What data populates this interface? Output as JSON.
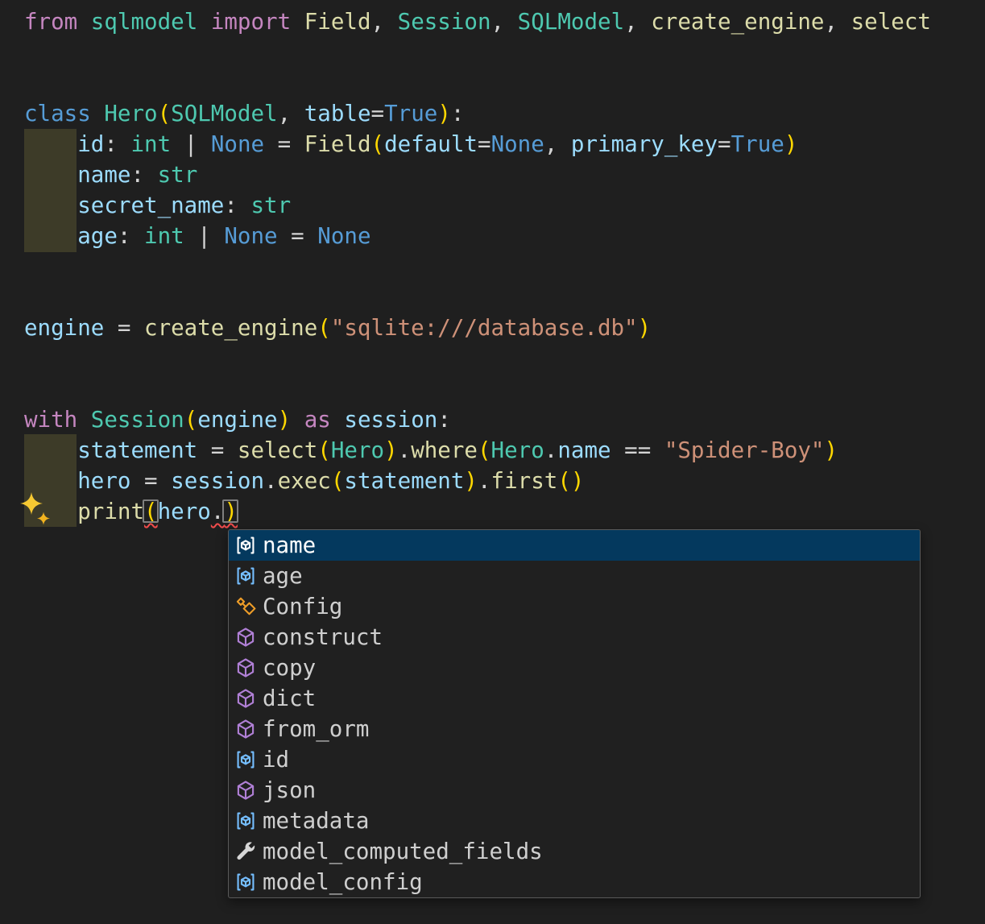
{
  "palette": {
    "editor_bg": "#1f1f1f",
    "keyword_pink": "#C586C0",
    "keyword_blue": "#569CD6",
    "class_teal": "#4EC9B0",
    "function_yellow": "#DCDCAA",
    "variable_blue": "#9CDCFE",
    "string_salmon": "#CE9178",
    "bracket_gold": "#FFD700",
    "error_squiggle": "#F14C4C",
    "indent_highlight": "#3d3b28",
    "suggest_bg": "#202020",
    "suggest_border": "#5a5a5a",
    "suggest_selected_bg": "#04395e",
    "sparkle_gold": "#F5C230"
  },
  "editor": {
    "lines": [
      [
        [
          "from ",
          "kw"
        ],
        [
          "sqlmodel",
          "type"
        ],
        [
          " ",
          "pl"
        ],
        [
          "import",
          "kw"
        ],
        [
          " ",
          "pl"
        ],
        [
          "Field",
          "fn"
        ],
        [
          ", ",
          "pl"
        ],
        [
          "Session",
          "type"
        ],
        [
          ", ",
          "pl"
        ],
        [
          "SQLModel",
          "type"
        ],
        [
          ", ",
          "pl"
        ],
        [
          "create_engine",
          "fn"
        ],
        [
          ", ",
          "pl"
        ],
        [
          "select",
          "fn"
        ]
      ],
      [],
      [],
      [
        [
          "class ",
          "kw2"
        ],
        [
          "Hero",
          "type"
        ],
        [
          "(",
          "br"
        ],
        [
          "SQLModel",
          "type"
        ],
        [
          ", ",
          "pl"
        ],
        [
          "table",
          "var"
        ],
        [
          "=",
          "pl"
        ],
        [
          "True",
          "const"
        ],
        [
          ")",
          "br"
        ],
        [
          ":",
          "pl"
        ]
      ],
      [
        [
          "    ",
          "pl"
        ],
        [
          "id",
          "var"
        ],
        [
          ": ",
          "pl"
        ],
        [
          "int",
          "type"
        ],
        [
          " | ",
          "pl"
        ],
        [
          "None",
          "const"
        ],
        [
          " = ",
          "pl"
        ],
        [
          "Field",
          "fn"
        ],
        [
          "(",
          "br"
        ],
        [
          "default",
          "var"
        ],
        [
          "=",
          "pl"
        ],
        [
          "None",
          "const"
        ],
        [
          ", ",
          "pl"
        ],
        [
          "primary_key",
          "var"
        ],
        [
          "=",
          "pl"
        ],
        [
          "True",
          "const"
        ],
        [
          ")",
          "br"
        ]
      ],
      [
        [
          "    ",
          "pl"
        ],
        [
          "name",
          "var"
        ],
        [
          ": ",
          "pl"
        ],
        [
          "str",
          "type"
        ]
      ],
      [
        [
          "    ",
          "pl"
        ],
        [
          "secret_name",
          "var"
        ],
        [
          ": ",
          "pl"
        ],
        [
          "str",
          "type"
        ]
      ],
      [
        [
          "    ",
          "pl"
        ],
        [
          "age",
          "var"
        ],
        [
          ": ",
          "pl"
        ],
        [
          "int",
          "type"
        ],
        [
          " | ",
          "pl"
        ],
        [
          "None",
          "const"
        ],
        [
          " = ",
          "pl"
        ],
        [
          "None",
          "const"
        ]
      ],
      [],
      [],
      [
        [
          "engine",
          "var"
        ],
        [
          " = ",
          "pl"
        ],
        [
          "create_engine",
          "fn"
        ],
        [
          "(",
          "br"
        ],
        [
          "\"sqlite:///database.db\"",
          "str"
        ],
        [
          ")",
          "br"
        ]
      ],
      [],
      [],
      [
        [
          "with ",
          "kw"
        ],
        [
          "Session",
          "type"
        ],
        [
          "(",
          "br"
        ],
        [
          "engine",
          "var"
        ],
        [
          ")",
          "br"
        ],
        [
          " as ",
          "kw"
        ],
        [
          "session",
          "var"
        ],
        [
          ":",
          "pl"
        ]
      ],
      [
        [
          "    ",
          "pl"
        ],
        [
          "statement",
          "var"
        ],
        [
          " = ",
          "pl"
        ],
        [
          "select",
          "fn"
        ],
        [
          "(",
          "br"
        ],
        [
          "Hero",
          "type"
        ],
        [
          ")",
          "br"
        ],
        [
          ".",
          "pl"
        ],
        [
          "where",
          "fn"
        ],
        [
          "(",
          "br"
        ],
        [
          "Hero",
          "type"
        ],
        [
          ".",
          "pl"
        ],
        [
          "name",
          "var"
        ],
        [
          " == ",
          "pl"
        ],
        [
          "\"Spider-Boy\"",
          "str"
        ],
        [
          ")",
          "br"
        ]
      ],
      [
        [
          "    ",
          "pl"
        ],
        [
          "hero",
          "var"
        ],
        [
          " = ",
          "pl"
        ],
        [
          "session",
          "var"
        ],
        [
          ".",
          "pl"
        ],
        [
          "exec",
          "fn"
        ],
        [
          "(",
          "br"
        ],
        [
          "statement",
          "var"
        ],
        [
          ")",
          "br"
        ],
        [
          ".",
          "pl"
        ],
        [
          "first",
          "fn"
        ],
        [
          "(",
          "br"
        ],
        [
          ")",
          "br"
        ]
      ],
      [
        [
          "    ",
          "pl"
        ],
        [
          "print",
          "fn"
        ],
        [
          "(",
          "br",
          "bm sq"
        ],
        [
          "hero",
          "var"
        ],
        [
          ".",
          "pl",
          "sq"
        ],
        [
          ")",
          "br",
          "bm sq"
        ]
      ]
    ]
  },
  "suggest": {
    "rows": [
      {
        "label": "name",
        "kind": "field",
        "selected": true
      },
      {
        "label": "age",
        "kind": "field",
        "selected": false
      },
      {
        "label": "Config",
        "kind": "class",
        "selected": false
      },
      {
        "label": "construct",
        "kind": "method",
        "selected": false
      },
      {
        "label": "copy",
        "kind": "method",
        "selected": false
      },
      {
        "label": "dict",
        "kind": "method",
        "selected": false
      },
      {
        "label": "from_orm",
        "kind": "method",
        "selected": false
      },
      {
        "label": "id",
        "kind": "field",
        "selected": false
      },
      {
        "label": "json",
        "kind": "method",
        "selected": false
      },
      {
        "label": "metadata",
        "kind": "field",
        "selected": false
      },
      {
        "label": "model_computed_fields",
        "kind": "property",
        "selected": false
      },
      {
        "label": "model_config",
        "kind": "field",
        "selected": false
      }
    ],
    "kind_colors": {
      "field": "#75BEFF",
      "class": "#EE9D28",
      "method": "#B180D7",
      "property": "#D6D6D6"
    }
  }
}
